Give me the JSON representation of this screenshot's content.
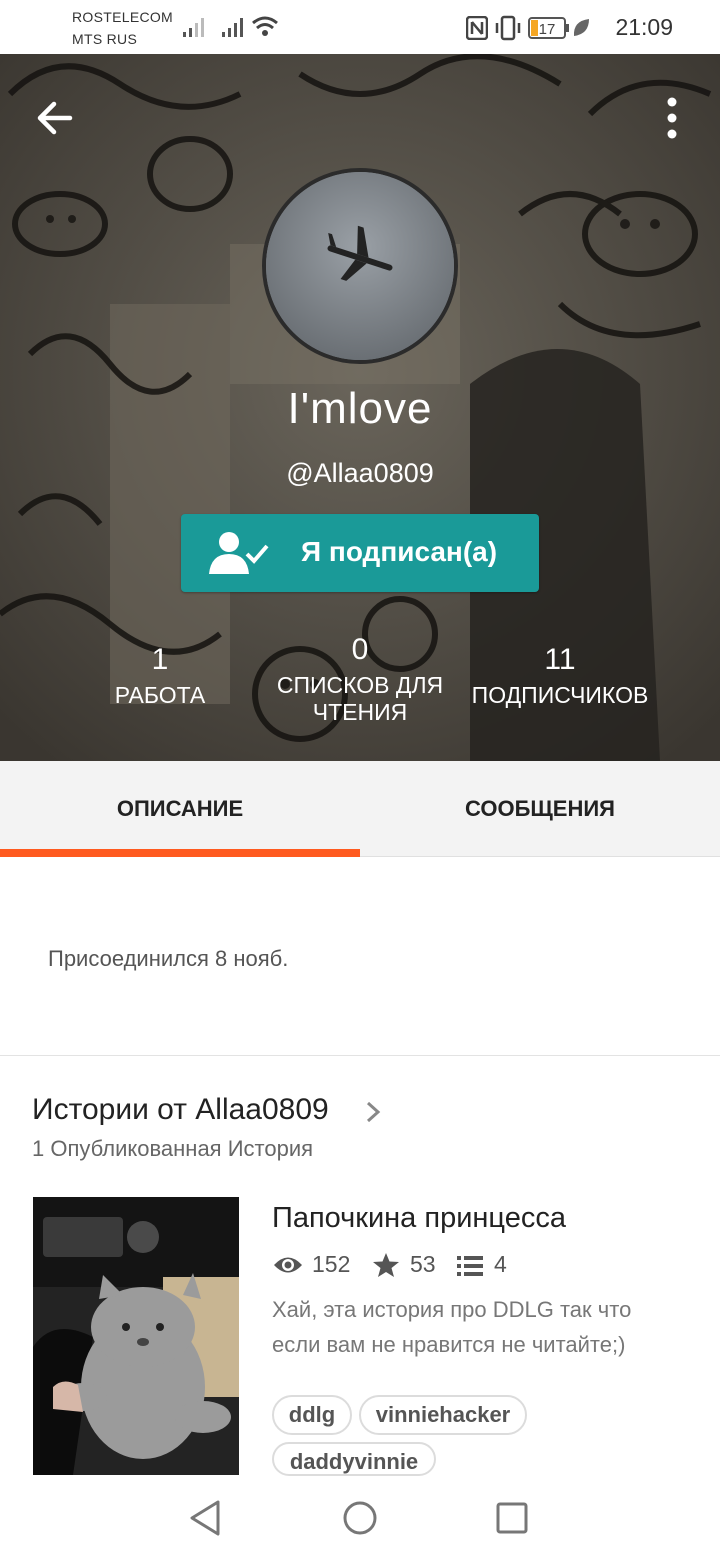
{
  "status_bar": {
    "carrier1": "ROSTELECOM",
    "carrier2": "MTS RUS",
    "battery": "17",
    "time": "21:09"
  },
  "profile": {
    "display_name": "I'mlove",
    "username": "@Allaa0809",
    "follow_label": "Я подписан(а)",
    "stats": [
      {
        "value": "1",
        "label": "РАБОТА"
      },
      {
        "value": "0",
        "label": "СПИСКОВ ДЛЯ ЧТЕНИЯ"
      },
      {
        "value": "11",
        "label": "ПОДПИСЧИКОВ"
      }
    ]
  },
  "tabs": [
    {
      "label": "ОПИСАНИЕ",
      "active": true
    },
    {
      "label": "СООБЩЕНИЯ",
      "active": false
    }
  ],
  "about": {
    "joined": "Присоединился 8 нояб."
  },
  "stories": {
    "title": "Истории от Allaa0809",
    "count_label": "1 Опубликованная История",
    "items": [
      {
        "title": "Папочкина принцесса",
        "reads": "152",
        "votes": "53",
        "parts": "4",
        "description": "Хай, эта история про  DDLG так что если вам не нравится не читайте;)",
        "tags": [
          "ddlg",
          "vinniehacker",
          "daddyvinnie"
        ]
      }
    ]
  },
  "colors": {
    "accent": "#ff5a1f",
    "follow_button": "#1a9a98"
  },
  "icons": {
    "back": "arrow-left",
    "menu": "vertical-dots",
    "follow": "person-check",
    "reads": "eye",
    "votes": "star",
    "parts": "list"
  }
}
